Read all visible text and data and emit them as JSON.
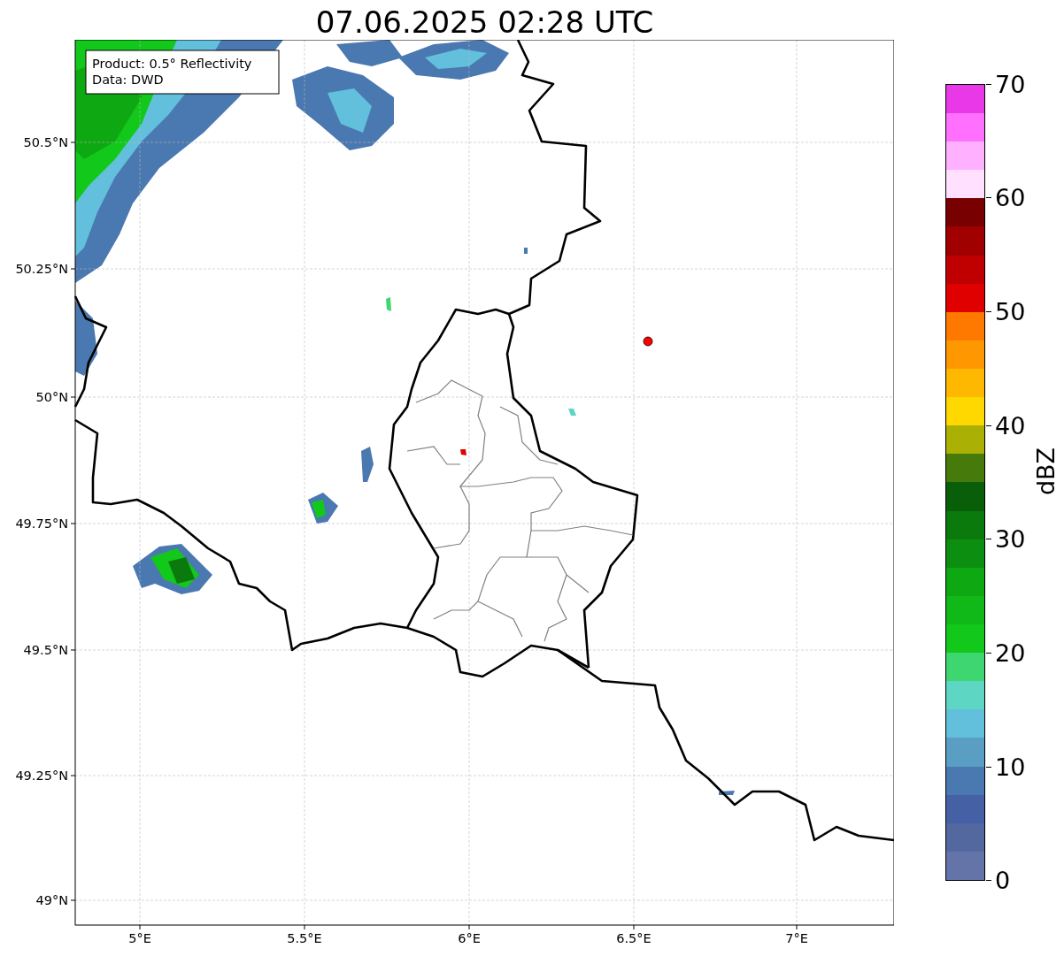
{
  "title": "07.06.2025 02:28 UTC",
  "map": {
    "attribution": [
      "Product: 0.5° Reflectivity",
      "Data: DWD"
    ],
    "y_ticks": [
      "50.5°N",
      "50.25°N",
      "50°N",
      "49.75°N",
      "49.5°N",
      "49.25°N",
      "49°N"
    ],
    "x_ticks": [
      "5°E",
      "5.5°E",
      "6°E",
      "6.5°E",
      "7°E"
    ]
  },
  "colorbar": {
    "label": "dBZ",
    "ticks": [
      "70",
      "60",
      "50",
      "40",
      "30",
      "20",
      "10",
      "0"
    ],
    "bins": [
      {
        "color": "#6473a8"
      },
      {
        "color": "#5468a0"
      },
      {
        "color": "#4560a5"
      },
      {
        "color": "#4a78b0"
      },
      {
        "color": "#5a9ec4"
      },
      {
        "color": "#62c0dc"
      },
      {
        "color": "#5ed6c4"
      },
      {
        "color": "#3dd670"
      },
      {
        "color": "#12c81a"
      },
      {
        "color": "#10b818"
      },
      {
        "color": "#0ea812"
      },
      {
        "color": "#0c8e10"
      },
      {
        "color": "#0b7a0d"
      },
      {
        "color": "#095e0a"
      },
      {
        "color": "#467a0a"
      },
      {
        "color": "#aab004"
      },
      {
        "color": "#ffd800"
      },
      {
        "color": "#ffb800"
      },
      {
        "color": "#ff9800"
      },
      {
        "color": "#ff7800"
      },
      {
        "color": "#e00000"
      },
      {
        "color": "#c00000"
      },
      {
        "color": "#a00000"
      },
      {
        "color": "#780000"
      },
      {
        "color": "#ffe0ff"
      },
      {
        "color": "#ffb0ff"
      },
      {
        "color": "#ff70ff"
      },
      {
        "color": "#e838e8"
      }
    ]
  }
}
